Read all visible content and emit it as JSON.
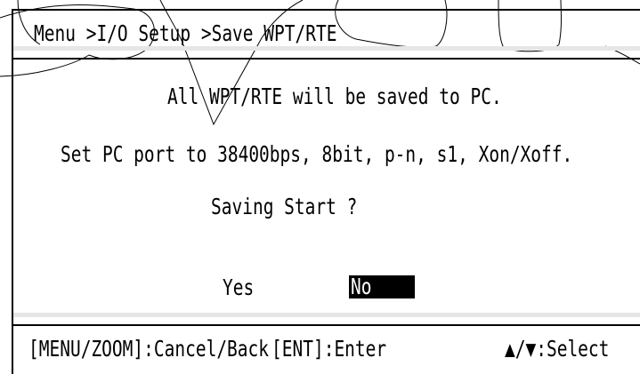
{
  "header": {
    "breadcrumb": "Menu >I/O Setup >Save WPT/RTE"
  },
  "body": {
    "line1": "All WPT/RTE will be saved to PC.",
    "line2": "Set PC port to 38400bps, 8bit, p-n, s1, Xon/Xoff.",
    "prompt": "Saving Start ?"
  },
  "choices": {
    "yes": "Yes",
    "no": "No",
    "selected": "No"
  },
  "footer": {
    "cancel_hint": "[MENU/ZOOM]:Cancel/Back",
    "enter_hint": "[ENT]:Enter",
    "select_hint": "▲/▼:Select"
  },
  "colors": {
    "text": "#000000",
    "background": "#ffffff",
    "highlight_bg": "#000000",
    "highlight_text": "#ffffff",
    "separator": "#e6e6e6"
  }
}
